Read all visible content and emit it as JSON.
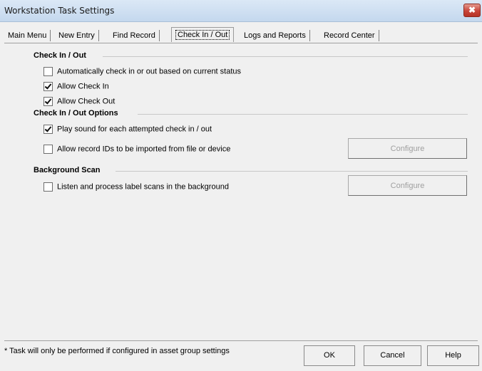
{
  "window": {
    "title": "Workstation Task Settings",
    "close_glyph": "✖"
  },
  "tabs": [
    {
      "label": "Main Menu",
      "active": false
    },
    {
      "label": "New Entry",
      "active": false
    },
    {
      "label": "Find Record",
      "active": false
    },
    {
      "label": "Check In / Out",
      "active": true
    },
    {
      "label": "Logs and Reports",
      "active": false
    },
    {
      "label": "Record Center",
      "active": false
    }
  ],
  "sections": {
    "check_in_out": {
      "title": "Check In / Out",
      "options": [
        {
          "label": "Automatically check in or out based on current status",
          "checked": false
        },
        {
          "label": "Allow Check In",
          "checked": true
        },
        {
          "label": "Allow Check Out",
          "checked": true
        }
      ]
    },
    "check_in_out_options": {
      "title": "Check In / Out Options",
      "options": [
        {
          "label": "Play sound for each attempted check in / out",
          "checked": true
        },
        {
          "label": "Allow record IDs to be imported from file or device",
          "checked": false
        }
      ],
      "configure_label": "Configure"
    },
    "background_scan": {
      "title": "Background Scan",
      "options": [
        {
          "label": "Listen and process label scans in the background",
          "checked": false
        }
      ],
      "configure_label": "Configure"
    }
  },
  "footer": {
    "note": "* Task will only be performed if configured in asset group settings",
    "ok_label": "OK",
    "cancel_label": "Cancel",
    "help_label": "Help"
  }
}
